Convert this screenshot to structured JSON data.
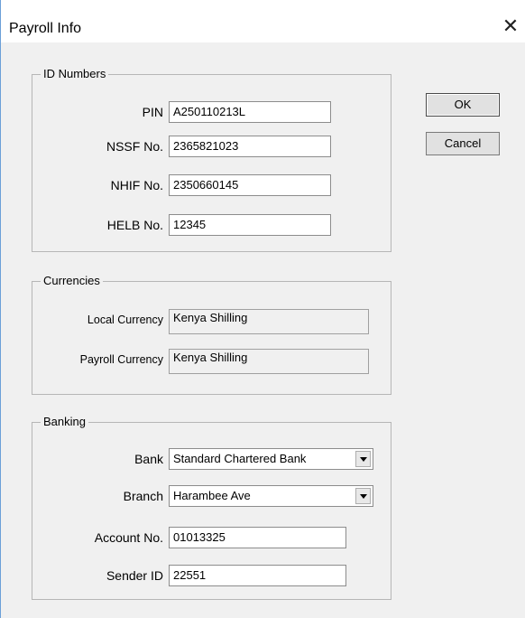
{
  "dialog": {
    "title": "Payroll Info",
    "close_glyph": "✕"
  },
  "id_numbers": {
    "legend": "ID Numbers",
    "pin": {
      "label": "PIN",
      "value": "A250110213L"
    },
    "nssf": {
      "label": "NSSF No.",
      "value": "2365821023"
    },
    "nhif": {
      "label": "NHIF No.",
      "value": "2350660145"
    },
    "helb": {
      "label": "HELB No.",
      "value": "12345"
    }
  },
  "currencies": {
    "legend": "Currencies",
    "local": {
      "label": "Local Currency",
      "value": "Kenya Shilling"
    },
    "payroll": {
      "label": "Payroll Currency",
      "value": "Kenya Shilling"
    }
  },
  "banking": {
    "legend": "Banking",
    "bank": {
      "label": "Bank",
      "value": "Standard Chartered Bank"
    },
    "branch": {
      "label": "Branch",
      "value": "Harambee Ave"
    },
    "account": {
      "label": "Account No.",
      "value": "01013325"
    },
    "sender": {
      "label": "Sender ID",
      "value": "22551"
    }
  },
  "buttons": {
    "ok": "OK",
    "cancel": "Cancel"
  },
  "icons": {
    "close": "close-icon",
    "dropdown": "chevron-down-icon"
  },
  "colors": {
    "titlebar": "#ffffff",
    "window_bg": "#f0f0f0",
    "border_accent": "#6b9fd8"
  }
}
